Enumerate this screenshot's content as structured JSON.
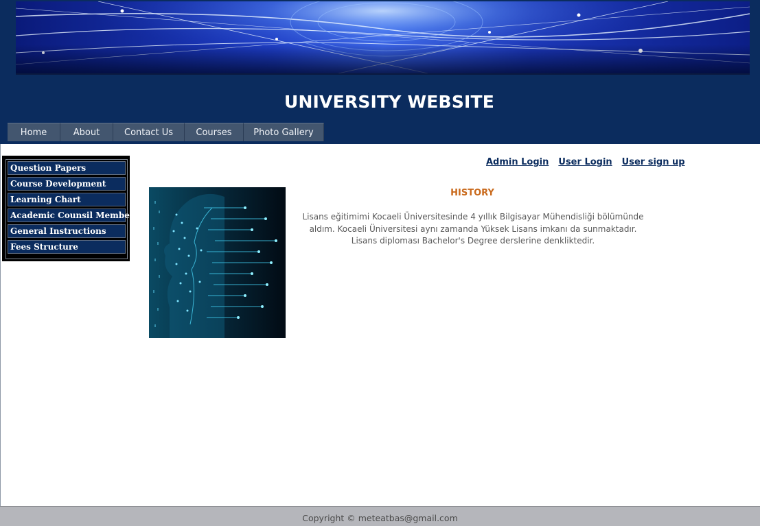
{
  "header": {
    "site_title": "UNIVERSITY WEBSITE",
    "banner_icon": "digital-brain-banner"
  },
  "nav": {
    "items": [
      {
        "label": "Home"
      },
      {
        "label": "About"
      },
      {
        "label": "Contact Us"
      },
      {
        "label": "Courses"
      },
      {
        "label": "Photo Gallery"
      }
    ]
  },
  "sidebar": {
    "items": [
      {
        "label": "Question Papers"
      },
      {
        "label": "Course Development"
      },
      {
        "label": "Learning Chart"
      },
      {
        "label": "Academic Counsil Members"
      },
      {
        "label": "General Instructions"
      },
      {
        "label": "Fees Structure"
      }
    ]
  },
  "login_links": {
    "admin": "Admin Login",
    "user": "User Login",
    "signup": "User sign up"
  },
  "content": {
    "image_icon": "ai-circuit-face-image",
    "heading": "HISTORY",
    "paragraph": "Lisans eğitimimi Kocaeli Üniversitesinde 4 yıllık Bilgisayar Mühendisliği bölümünde aldım. Kocaeli Üniversitesi aynı zamanda Yüksek Lisans imkanı da sunmaktadır. Lisans diploması Bachelor's Degree derslerine denkliktedir."
  },
  "footer": {
    "copyright": "Copyright © meteatbas@gmail.com"
  },
  "colors": {
    "header_bg": "#0b2c5e",
    "nav_bg": "#43566f",
    "heading_accent": "#c9691b",
    "footer_bg": "#b5b6bb"
  }
}
